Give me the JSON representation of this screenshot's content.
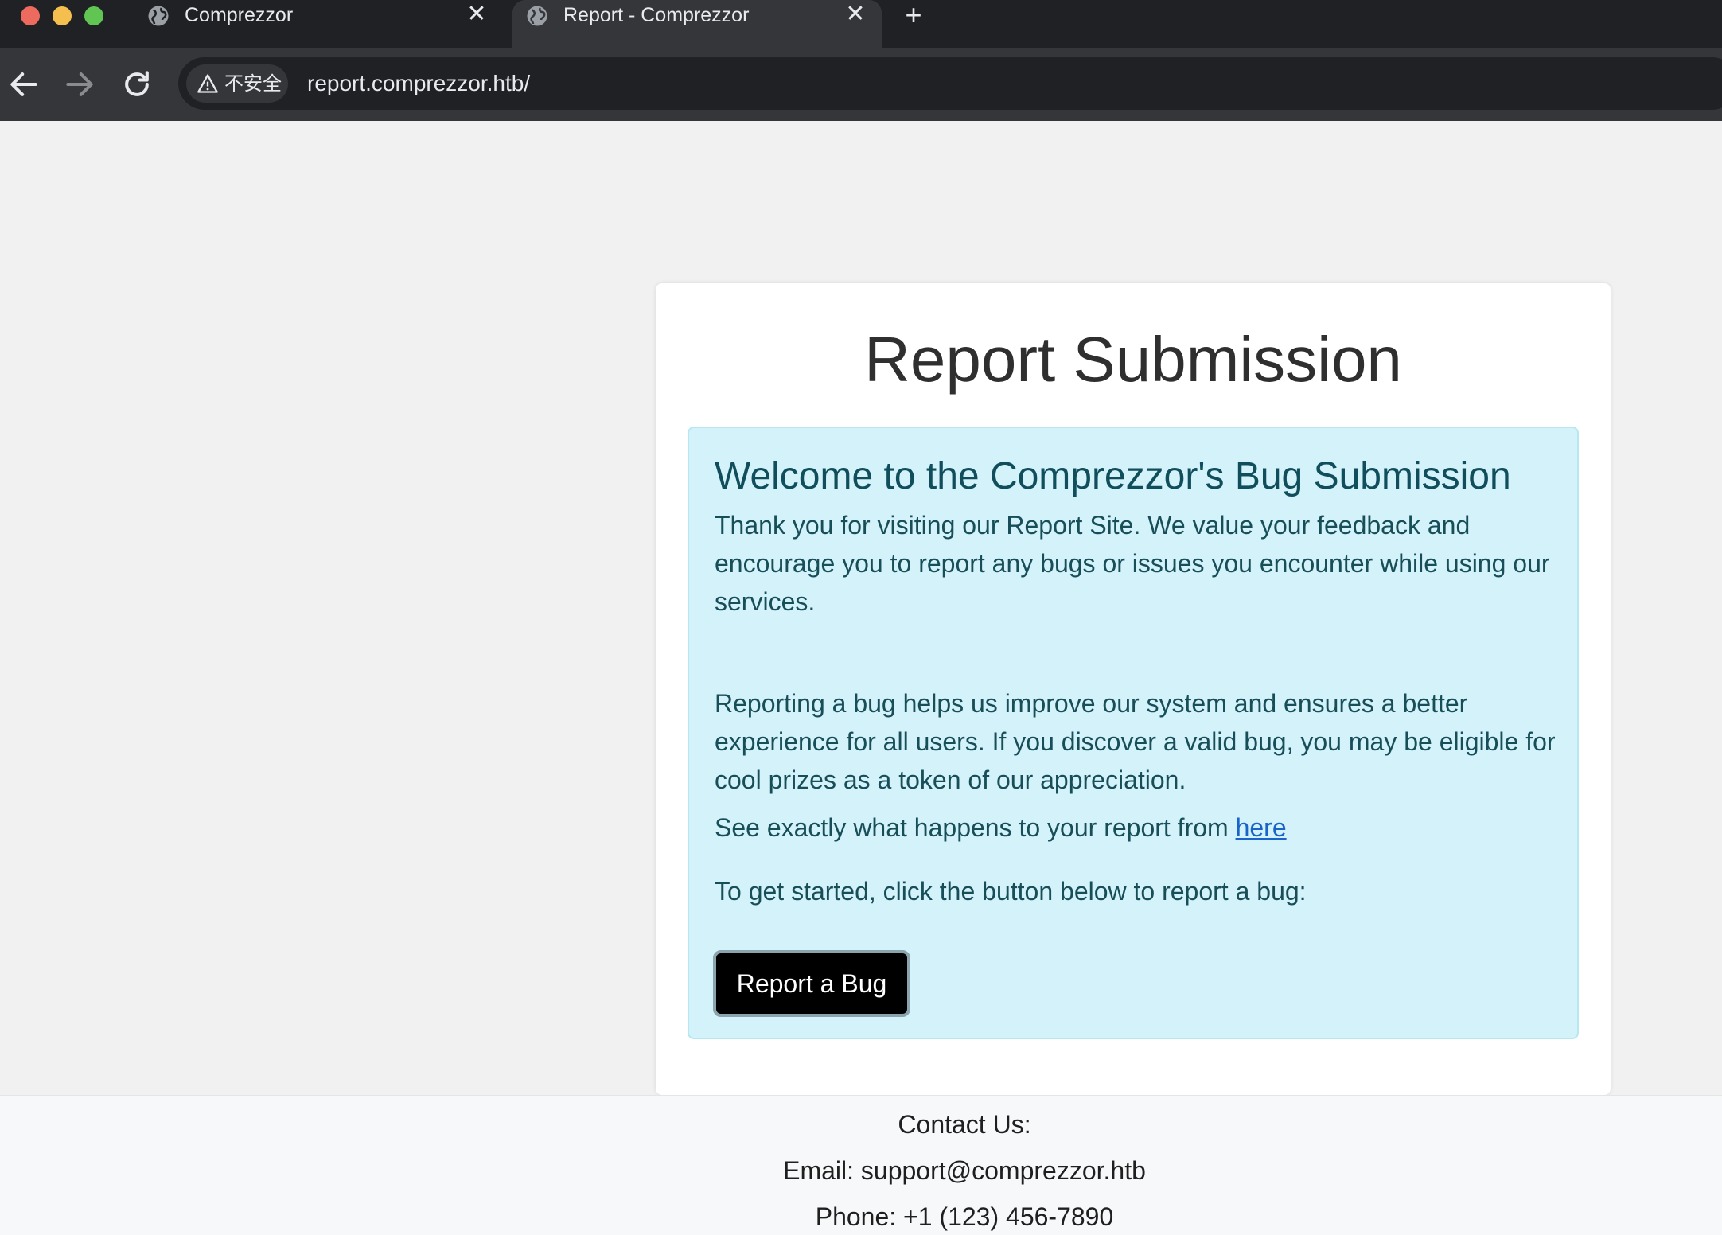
{
  "browser": {
    "tabs": [
      {
        "title": "Comprezzor",
        "icon": "globe-icon",
        "active": false
      },
      {
        "title": "Report - Comprezzor",
        "icon": "globe-icon",
        "active": true
      }
    ],
    "new_tab_symbol": "+",
    "close_symbol": "✕",
    "security_label": "不安全",
    "url": "report.comprezzor.htb/",
    "colors": {
      "tabbar_bg": "#202124",
      "toolbar_bg": "#35363a",
      "traffic_red": "#ed6a5e",
      "traffic_yellow": "#f5bf4f",
      "traffic_green": "#61c554"
    }
  },
  "main": {
    "title": "Report Submission",
    "alert": {
      "heading": "Welcome to the Comprezzor's Bug Submission",
      "paragraph1": "Thank you for visiting our Report Site. We value your feedback and encourage you to report any bugs or issues you encounter while using our services.",
      "paragraph2": "Reporting a bug helps us improve our system and ensures a better experience for all users. If you discover a valid bug, you may be eligible for cool prizes as a token of our appreciation.",
      "paragraph3_prefix": "See exactly what happens to your report from ",
      "paragraph3_link": "here",
      "paragraph4": "To get started, click the button below to report a bug:",
      "colors": {
        "background": "#d3f2fa",
        "border": "#b8e7f4",
        "text": "#0f4f5b",
        "link": "#1a63c9"
      }
    },
    "report_button_label": "Report a Bug"
  },
  "footer": {
    "contact_heading": "Contact Us:",
    "email_line": "Email: support@comprezzor.htb",
    "phone_line": "Phone: +1 (123) 456-7890"
  }
}
